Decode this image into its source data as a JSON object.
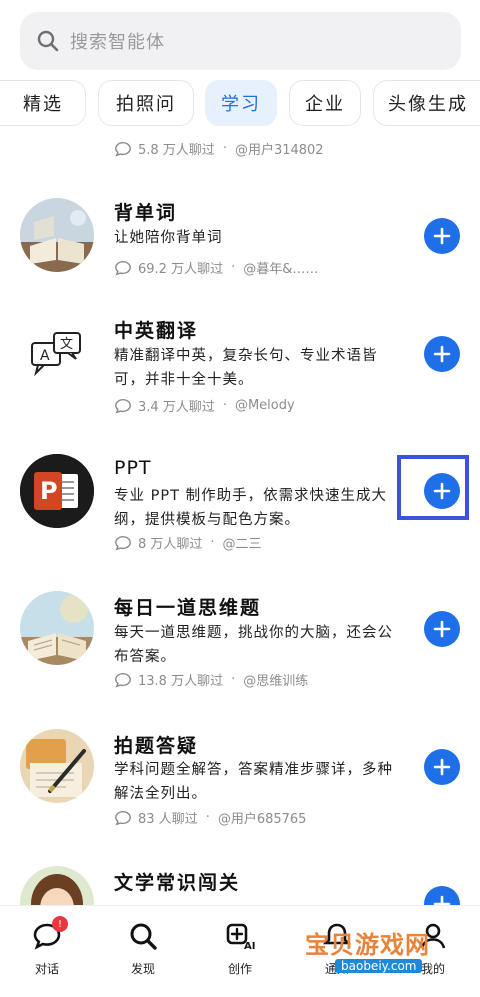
{
  "search": {
    "placeholder": "搜索智能体"
  },
  "tabs": [
    "精选",
    "拍照问",
    "学习",
    "企业",
    "头像生成"
  ],
  "partial_meta": {
    "count": "5.8 万人聊过",
    "author": "@用户314802"
  },
  "agents": [
    {
      "title": "背单词",
      "desc": "让她陪你背单词",
      "count": "69.2 万人聊过",
      "author": "@暮年&……",
      "avatar_icon": "book-avatar-icon"
    },
    {
      "title": "中英翻译",
      "desc": "精准翻译中英，复杂长句、专业术语皆可，并非十全十美。",
      "count": "3.4 万人聊过",
      "author": "@Melody",
      "avatar_icon": "translate-avatar-icon"
    },
    {
      "title": "PPT",
      "desc": "专业 PPT 制作助手，依需求快速生成大纲，提供模板与配色方案。",
      "count": "8 万人聊过",
      "author": "@二三",
      "avatar_icon": "ppt-avatar-icon"
    },
    {
      "title": "每日一道思维题",
      "desc": "每天一道思维题，挑战你的大脑，还会公布答案。",
      "count": "13.8 万人聊过",
      "author": "@思维训练",
      "avatar_icon": "open-book-avatar-icon"
    },
    {
      "title": "拍题答疑",
      "desc": "学科问题全解答，答案精准步骤详，多种解法全列出。",
      "count": "83 人聊过",
      "author": "@用户685765",
      "avatar_icon": "pen-avatar-icon"
    },
    {
      "title": "文学常识闯关",
      "desc": "",
      "count": "",
      "author": "",
      "avatar_icon": "girl-avatar-icon"
    }
  ],
  "nav": [
    {
      "label": "对话",
      "icon": "chat-icon",
      "badge": "!"
    },
    {
      "label": "发现",
      "icon": "search-icon"
    },
    {
      "label": "创作",
      "icon": "create-ai-icon"
    },
    {
      "label": "通知",
      "icon": "bell-icon"
    },
    {
      "label": "我的",
      "icon": "profile-icon"
    }
  ],
  "watermark": {
    "text": "宝贝游戏网",
    "url": "baobeiy.com"
  },
  "colors": {
    "accent": "#1f6fe8",
    "active_tab_bg": "#e7f1fd",
    "highlight": "#3a55d6",
    "badge": "#e8383d"
  }
}
